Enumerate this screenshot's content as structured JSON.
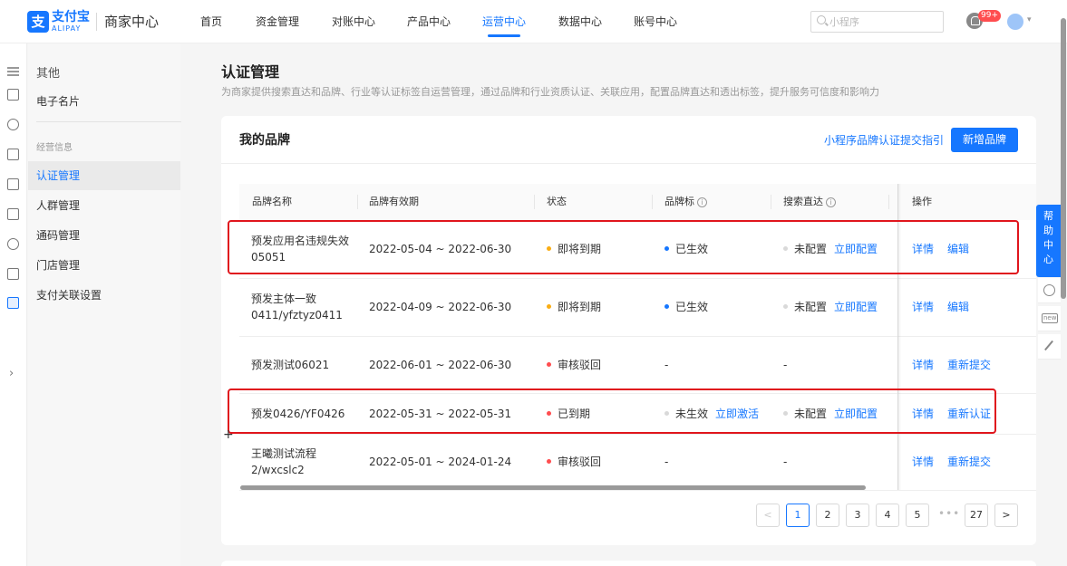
{
  "header": {
    "logo_glyph": "支",
    "logo_text": "支付宝",
    "logo_sub": "ALIPAY",
    "brand": "商家中心",
    "nav": [
      "首页",
      "资金管理",
      "对账中心",
      "产品中心",
      "运营中心",
      "数据中心",
      "账号中心"
    ],
    "active_nav": "运营中心",
    "search_placeholder": "小程序",
    "badge": "99+"
  },
  "sidemenu": {
    "top_item": "其他",
    "item_card": "电子名片",
    "group_label": "经营信息",
    "items": [
      "认证管理",
      "人群管理",
      "通码管理",
      "门店管理",
      "支付关联设置"
    ],
    "active": "认证管理"
  },
  "page": {
    "title": "认证管理",
    "description": "为商家提供搜索直达和品牌、行业等认证标签自运营管理，通过品牌和行业资质认证、关联应用，配置品牌直达和透出标签，提升服务可信度和影响力"
  },
  "card": {
    "title": "我的品牌",
    "guide_link": "小程序品牌认证提交指引",
    "add_button": "新增品牌",
    "columns": [
      "品牌名称",
      "品牌有效期",
      "状态",
      "品牌标",
      "搜索直达",
      "操作"
    ],
    "rows": [
      {
        "name_line1": "预发应用名违规失效",
        "name_line2": "05051",
        "period": "2022-05-04 ~ 2022-06-30",
        "status": "即将到期",
        "status_color": "#faad14",
        "brand_mark": "已生效",
        "brand_mark_color": "#1677ff",
        "brand_mark_action": "",
        "search": "未配置",
        "search_action": "立即配置",
        "op1": "详情",
        "op2": "编辑"
      },
      {
        "name_line1": "预发主体一致",
        "name_line2": "0411/yfztyz0411",
        "period": "2022-04-09 ~ 2022-06-30",
        "status": "即将到期",
        "status_color": "#faad14",
        "brand_mark": "已生效",
        "brand_mark_color": "#1677ff",
        "brand_mark_action": "",
        "search": "未配置",
        "search_action": "立即配置",
        "op1": "详情",
        "op2": "编辑"
      },
      {
        "name_line1": "预发测试06021",
        "name_line2": "",
        "period": "2022-06-01 ~ 2022-06-30",
        "status": "审核驳回",
        "status_color": "#ff4d4f",
        "brand_mark": "-",
        "brand_mark_color": "",
        "brand_mark_action": "",
        "search": "-",
        "search_action": "",
        "op1": "详情",
        "op2": "重新提交"
      },
      {
        "name_line1": "预发0426/YF0426",
        "name_line2": "",
        "period": "2022-05-31 ~ 2022-05-31",
        "status": "已到期",
        "status_color": "#ff4d4f",
        "brand_mark": "未生效",
        "brand_mark_color": "#d9d9d9",
        "brand_mark_action": "立即激活",
        "search": "未配置",
        "search_action": "立即配置",
        "op1": "详情",
        "op2": "重新认证"
      },
      {
        "name_line1": "王曦测试流程",
        "name_line2": "2/wxcslc2",
        "period": "2022-05-01 ~ 2024-01-24",
        "status": "审核驳回",
        "status_color": "#ff4d4f",
        "brand_mark": "-",
        "brand_mark_color": "",
        "brand_mark_action": "",
        "search": "-",
        "search_action": "",
        "op1": "详情",
        "op2": "重新提交"
      }
    ]
  },
  "pagination": {
    "prev": "<",
    "pages": [
      "1",
      "2",
      "3",
      "4",
      "5"
    ],
    "current": "1",
    "ellipsis": "•••",
    "last": "27",
    "next": ">"
  },
  "help": {
    "chars": [
      "帮",
      "助",
      "中",
      "心"
    ],
    "new_label": "new"
  }
}
